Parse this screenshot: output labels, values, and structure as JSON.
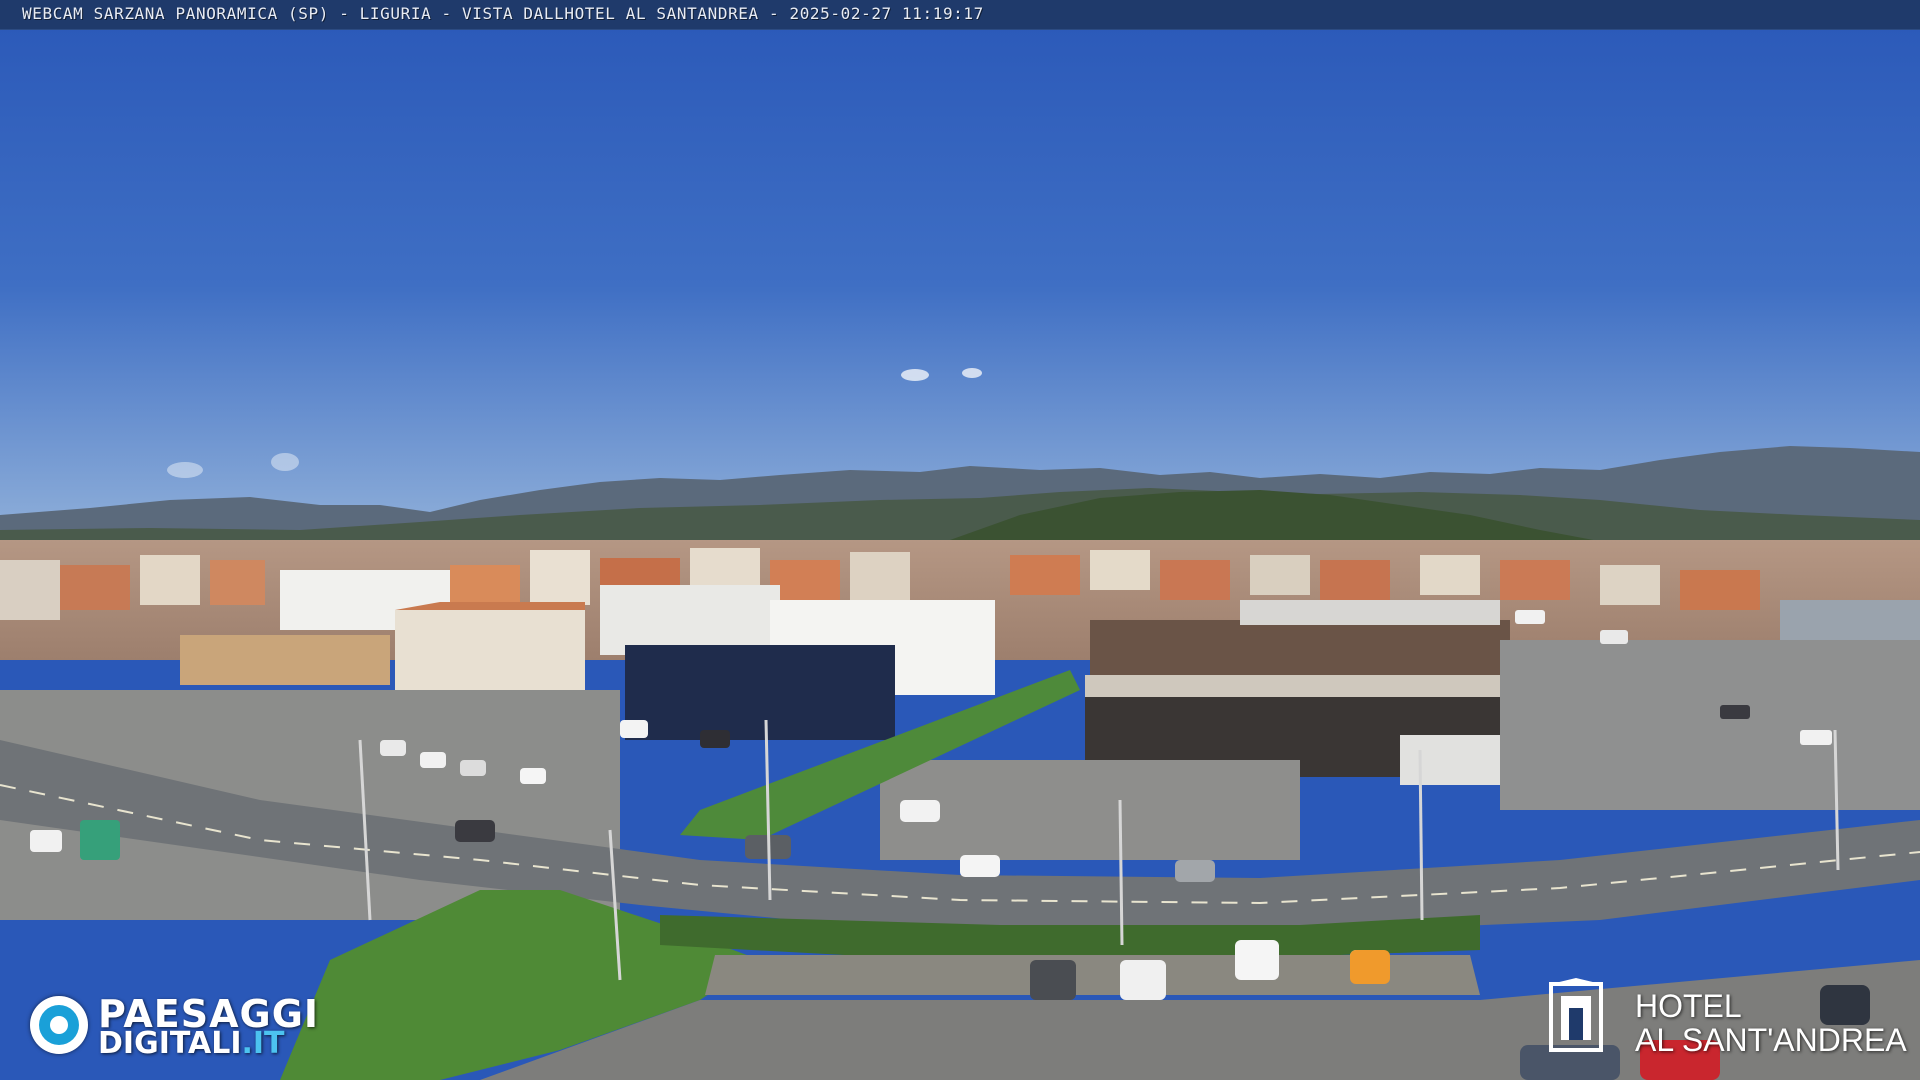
{
  "overlay": {
    "title": "WEBCAM SARZANA PANORAMICA (SP) - LIGURIA - VISTA DALLHOTEL AL SANTANDREA - 2025-02-27   11:19:17"
  },
  "logos": {
    "left_line1": "PAESAGGI",
    "left_line2_a": "DIGITALI",
    "left_line2_b": ".IT",
    "right_line1": "HOTEL",
    "right_line2": "AL SANT'ANDREA"
  },
  "colors": {
    "sky_top": "#2a58b8",
    "sky_horizon": "#7ea3d6",
    "mountains": "#4a5868",
    "hills_green": "#3d5a3a",
    "roofs": "#c8734a",
    "road": "#6f7377",
    "grass": "#4e8a3a",
    "title_bar": "#1f3a6b",
    "logo_accent": "#1aa0d8"
  }
}
